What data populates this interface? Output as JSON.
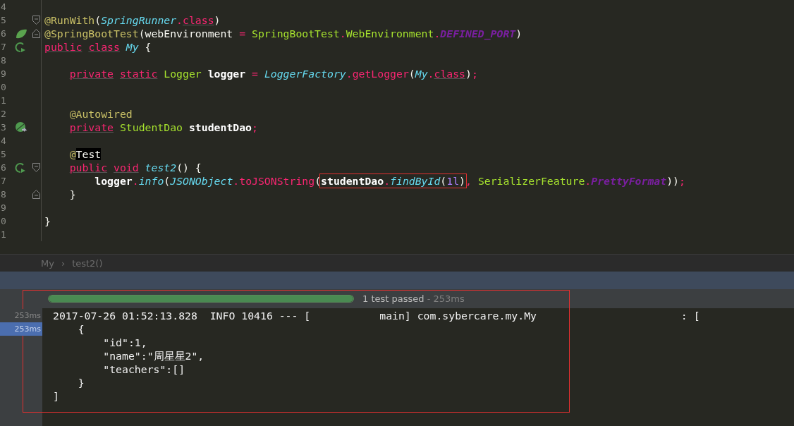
{
  "editor": {
    "lines": [
      {
        "number": "4"
      },
      {
        "number": "5",
        "fold": {
          "kind": "start"
        },
        "tokens": [
          {
            "kind": "annotation",
            "text": "@RunWith"
          },
          {
            "kind": "plain",
            "text": "("
          },
          {
            "kind": "italic",
            "text": "SpringRunner"
          },
          {
            "kind": "punct",
            "text": "."
          },
          {
            "kind": "keyword",
            "text": "class"
          },
          {
            "kind": "plain",
            "text": ")"
          }
        ]
      },
      {
        "number": "6",
        "gutter": {
          "kind": "leaf"
        },
        "fold": {
          "kind": "end"
        },
        "tokens": [
          {
            "kind": "annotation",
            "text": "@SpringBootTest"
          },
          {
            "kind": "plain",
            "text": "(webEnvironment "
          },
          {
            "kind": "punct",
            "text": "="
          },
          {
            "kind": "type",
            "text": " SpringBootTest"
          },
          {
            "kind": "punct",
            "text": "."
          },
          {
            "kind": "type",
            "text": "WebEnvironment"
          },
          {
            "kind": "punct",
            "text": "."
          },
          {
            "kind": "constant",
            "text": "DEFINED_PORT"
          },
          {
            "kind": "plain",
            "text": ")"
          }
        ]
      },
      {
        "number": "7",
        "gutter": {
          "kind": "run"
        },
        "tokens": [
          {
            "kind": "keyword",
            "text": "public"
          },
          {
            "kind": "keyword",
            "text": " class"
          },
          {
            "kind": "italic",
            "text": " My"
          },
          {
            "kind": "plain",
            "text": " {"
          }
        ]
      },
      {
        "number": "8"
      },
      {
        "number": "9",
        "tokens": [
          {
            "kind": "keyword",
            "text": "    private"
          },
          {
            "kind": "keyword",
            "text": " static"
          },
          {
            "kind": "type",
            "text": " Logger"
          },
          {
            "kind": "bold",
            "text": " logger"
          },
          {
            "kind": "punct",
            "text": " ="
          },
          {
            "kind": "italic",
            "text": " LoggerFactory"
          },
          {
            "kind": "punct",
            "text": "."
          },
          {
            "kind": "method",
            "text": "getLogger"
          },
          {
            "kind": "plain",
            "text": "("
          },
          {
            "kind": "italic",
            "text": "My"
          },
          {
            "kind": "punct",
            "text": "."
          },
          {
            "kind": "keyword",
            "text": "class"
          },
          {
            "kind": "plain",
            "text": ")"
          },
          {
            "kind": "punct",
            "text": ";"
          }
        ]
      },
      {
        "number": "0"
      },
      {
        "number": "1"
      },
      {
        "number": "2",
        "tokens": [
          {
            "kind": "annotation",
            "text": "    @Autowired"
          }
        ]
      },
      {
        "number": "3",
        "gutter": {
          "kind": "bean"
        },
        "tokens": [
          {
            "kind": "keyword",
            "text": "    private"
          },
          {
            "kind": "type",
            "text": " StudentDao"
          },
          {
            "kind": "bold",
            "text": " studentDao"
          },
          {
            "kind": "punct",
            "text": ";"
          }
        ]
      },
      {
        "number": "4"
      },
      {
        "number": "5",
        "tokens": [
          {
            "kind": "annotation",
            "text": "    @"
          },
          {
            "kind": "marked",
            "text": "Test"
          }
        ]
      },
      {
        "number": "6",
        "gutter": {
          "kind": "run"
        },
        "fold": {
          "kind": "start"
        },
        "tokens": [
          {
            "kind": "keyword",
            "text": "    public"
          },
          {
            "kind": "keyword",
            "text": " void"
          },
          {
            "kind": "italic",
            "text": " test2"
          },
          {
            "kind": "plain",
            "text": "() {"
          }
        ]
      },
      {
        "number": "7",
        "tokens": [
          {
            "kind": "bold",
            "text": "        logger"
          },
          {
            "kind": "punct",
            "text": "."
          },
          {
            "kind": "italic",
            "text": "info"
          },
          {
            "kind": "plain",
            "text": "("
          },
          {
            "kind": "italic",
            "text": "JSONObject"
          },
          {
            "kind": "punct",
            "text": "."
          },
          {
            "kind": "method",
            "text": "toJSONString"
          },
          {
            "kind": "plain",
            "text": "("
          },
          {
            "kind": "bold",
            "text": "studentDao",
            "boxed": true
          },
          {
            "kind": "punct",
            "text": ".",
            "boxed": true
          },
          {
            "kind": "italic",
            "text": "findById",
            "boxed": true
          },
          {
            "kind": "plain",
            "text": "(",
            "boxed": true
          },
          {
            "kind": "number",
            "text": "1l",
            "boxed": true
          },
          {
            "kind": "plain",
            "text": ")",
            "boxed": true
          },
          {
            "kind": "punct",
            "text": ","
          },
          {
            "kind": "type",
            "text": " SerializerFeature"
          },
          {
            "kind": "punct",
            "text": "."
          },
          {
            "kind": "constant",
            "text": "PrettyFormat"
          },
          {
            "kind": "plain",
            "text": "))"
          },
          {
            "kind": "punct",
            "text": ";"
          }
        ]
      },
      {
        "number": "8",
        "fold": {
          "kind": "end"
        },
        "tokens": [
          {
            "kind": "plain",
            "text": "    }"
          }
        ]
      },
      {
        "number": "9"
      },
      {
        "number": "0",
        "tokens": [
          {
            "kind": "plain",
            "text": "}"
          }
        ]
      },
      {
        "number": "1"
      }
    ]
  },
  "breadcrumb": {
    "items": [
      "My",
      "test2()"
    ],
    "separator": "›"
  },
  "test_results": {
    "progress": {
      "level": 1
    },
    "status": "1 test passed",
    "duration": " - 253ms",
    "highlighted": true
  },
  "console": {
    "timings": [
      {
        "text": "253ms",
        "selected": false
      },
      {
        "text": "253ms",
        "selected": true
      }
    ],
    "lines": [
      "2017-07-26 01:52:13.828  INFO 10416 --- [           main] com.sybercare.my.My                       : [",
      "    {",
      "        \"id\":1,",
      "        \"name\":\"周星星2\",",
      "        \"teachers\":[]",
      "    }",
      "]"
    ]
  }
}
